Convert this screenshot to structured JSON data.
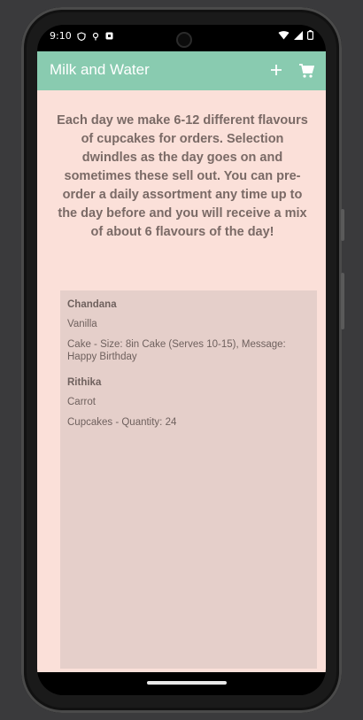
{
  "status": {
    "time": "9:10"
  },
  "appbar": {
    "title": "Milk and Water",
    "add_icon": "plus-icon",
    "cart_icon": "cart-icon"
  },
  "intro": {
    "text": "Each day we make 6-12 different flavours of cupcakes for orders. Selection dwindles as the day goes on and sometimes these sell out. You can pre-order a daily assortment any time up to the day before and you will receive a mix of about 6 flavours of the day!"
  },
  "orders": [
    {
      "name": "Chandana",
      "flavour": "Vanilla",
      "details": "Cake - Size: 8in Cake (Serves 10-15), Message: Happy Birthday"
    },
    {
      "name": "Rithika",
      "flavour": "Carrot",
      "details": "Cupcakes - Quantity: 24"
    }
  ],
  "colors": {
    "appbar": "#89cbb0",
    "background": "#fbe0d9",
    "orders_panel": "#e5cfca",
    "text": "#7a6a66"
  }
}
